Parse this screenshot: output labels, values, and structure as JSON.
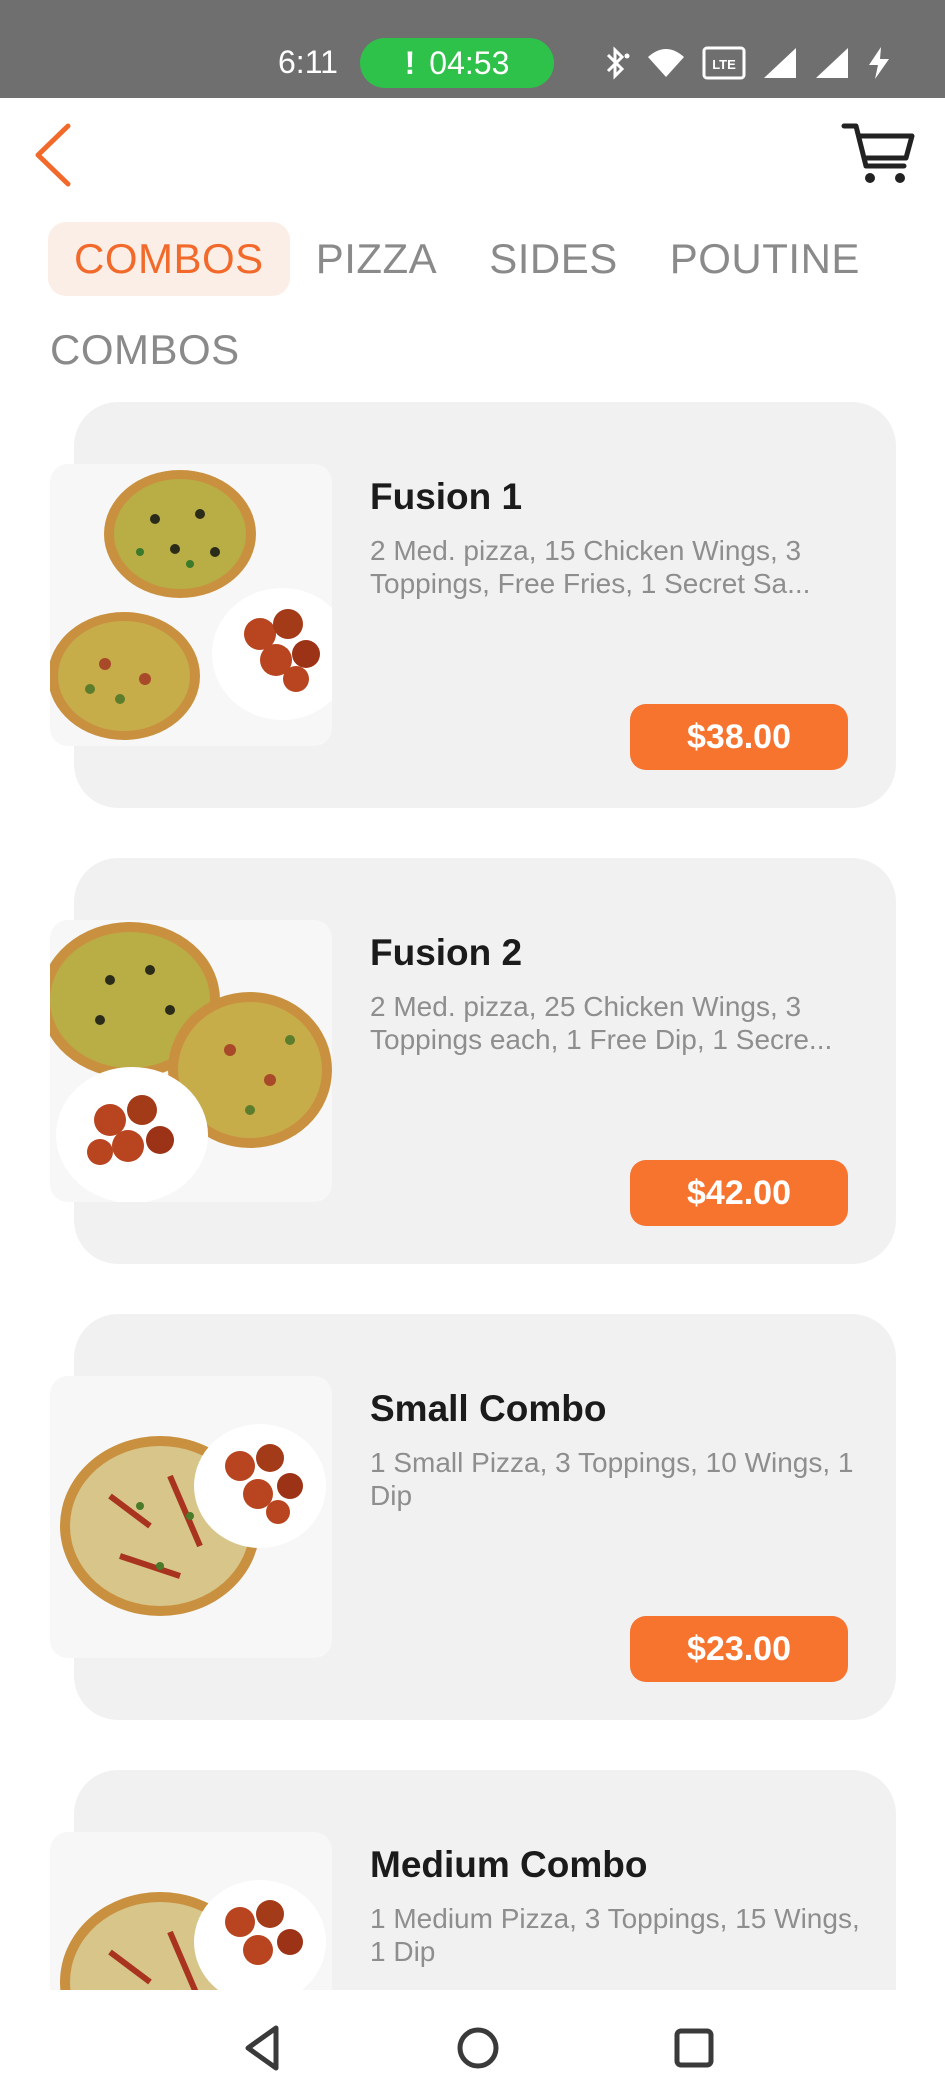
{
  "status_bar": {
    "time": "6:11",
    "call_indicator": "!",
    "call_timer": "04:53",
    "icons": [
      "bluetooth-icon",
      "wifi-icon",
      "volte-icon",
      "signal-icon",
      "signal-icon",
      "charging-icon"
    ],
    "volte_label": "LTE",
    "pill_color": "#2fc24a"
  },
  "header": {
    "back_icon": "chevron-left-icon",
    "cart_icon": "cart-icon",
    "accent": "#f26a2b"
  },
  "tabs": [
    {
      "label": "COMBOS",
      "active": true
    },
    {
      "label": "PIZZA",
      "active": false
    },
    {
      "label": "SIDES",
      "active": false
    },
    {
      "label": "POUTINE",
      "active": false
    }
  ],
  "section": {
    "title": "COMBOS"
  },
  "items": [
    {
      "name": "Fusion 1",
      "description": "2 Med. pizza, 15 Chicken Wings, 3 Toppings, Free Fries, 1 Secret Sa...",
      "price": "$38.00"
    },
    {
      "name": "Fusion 2",
      "description": "2 Med. pizza, 25 Chicken Wings, 3 Toppings each, 1 Free Dip, 1 Secre...",
      "price": "$42.00"
    },
    {
      "name": "Small Combo",
      "description": "1 Small Pizza, 3 Toppings, 10 Wings, 1 Dip",
      "price": "$23.00"
    },
    {
      "name": "Medium Combo",
      "description": "1 Medium Pizza, 3 Toppings, 15 Wings, 1 Dip",
      "price": ""
    }
  ],
  "price_color": "#f7742f",
  "nav": {
    "back": "triangle-back-icon",
    "home": "circle-home-icon",
    "recents": "square-recents-icon"
  }
}
